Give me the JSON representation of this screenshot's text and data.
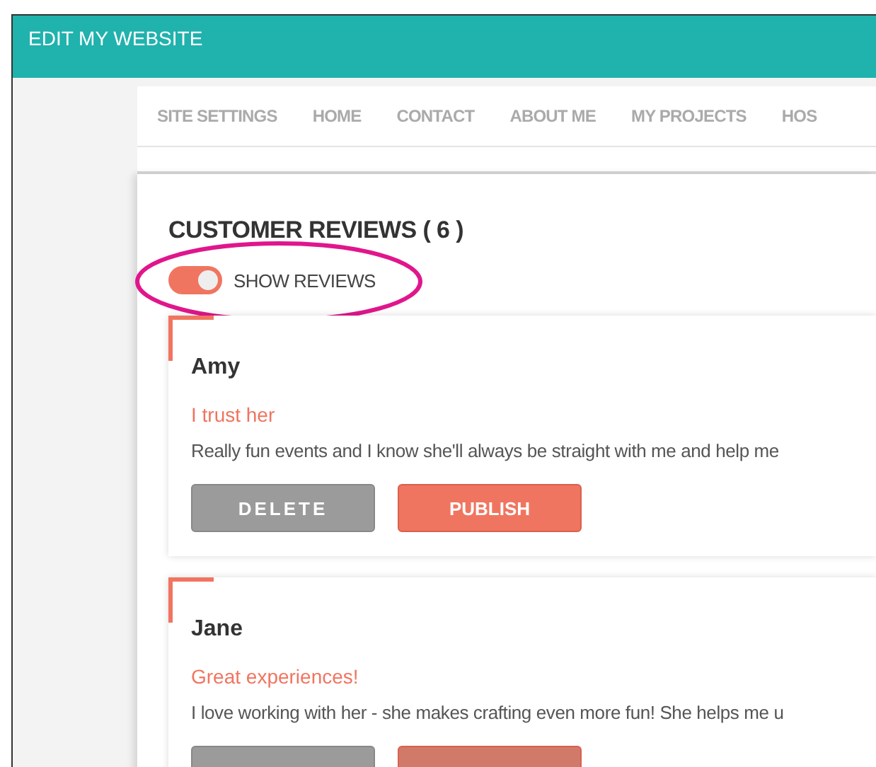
{
  "header": {
    "title": "EDIT MY WEBSITE"
  },
  "nav": [
    {
      "label": "SITE SETTINGS",
      "selected": false
    },
    {
      "label": "HOME",
      "selected": false
    },
    {
      "label": "CONTACT",
      "selected": false
    },
    {
      "label": "ABOUT ME",
      "selected": false
    },
    {
      "label": "MY PROJECTS",
      "selected": false
    },
    {
      "label": "HOS",
      "selected": false
    }
  ],
  "section": {
    "title": "CUSTOMER REVIEWS ( 6 )",
    "toggle": {
      "label": "SHOW REVIEWS",
      "on": true,
      "highlighted": true
    }
  },
  "reviews": [
    {
      "name": "Amy",
      "headline": "I trust her",
      "text": "Really fun events and I know she'll always be straight with me and help me",
      "buttons": [
        {
          "kind": "delete",
          "label": "DELETE",
          "dimmed": false
        },
        {
          "kind": "publish",
          "label": "PUBLISH",
          "dimmed": false
        }
      ]
    },
    {
      "name": "Jane",
      "headline": "Great experiences!",
      "text": "I love working with her - she makes crafting even more fun! She helps me u",
      "buttons": [
        {
          "kind": "delete",
          "dimmed": false
        },
        {
          "kind": "publish",
          "dimmed": true
        }
      ]
    }
  ]
}
